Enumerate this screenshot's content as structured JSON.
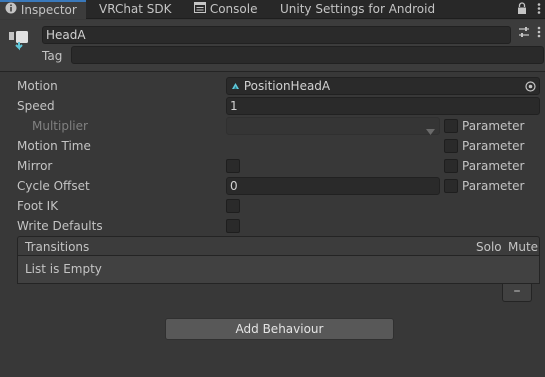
{
  "tabs": [
    {
      "label": "Inspector",
      "icon": "info-icon",
      "active": true
    },
    {
      "label": "VRChat SDK",
      "active": false
    },
    {
      "label": "Console",
      "icon": "console-icon",
      "active": false
    },
    {
      "label": "Unity Settings for Android",
      "active": false
    }
  ],
  "header": {
    "name": "HeadA",
    "tag_label": "Tag",
    "tag_value": ""
  },
  "properties": {
    "motion": {
      "label": "Motion",
      "value": "PositionHeadA"
    },
    "speed": {
      "label": "Speed",
      "value": "1"
    },
    "multiplier": {
      "label": "Multiplier",
      "value": ""
    },
    "motion_time": {
      "label": "Motion Time"
    },
    "mirror": {
      "label": "Mirror"
    },
    "cycle_offset": {
      "label": "Cycle Offset",
      "value": "0"
    },
    "foot_ik": {
      "label": "Foot IK"
    },
    "write_defaults": {
      "label": "Write Defaults"
    },
    "parameter_label": "Parameter"
  },
  "transitions": {
    "title": "Transitions",
    "col_solo": "Solo",
    "col_mute": "Mute",
    "empty_text": "List is Empty",
    "remove_label": "–"
  },
  "add_behaviour_label": "Add Behaviour",
  "colors": {
    "background": "#383838",
    "tab_accent": "#3a79bb",
    "gameobject_icon": "#5fc7d9"
  }
}
